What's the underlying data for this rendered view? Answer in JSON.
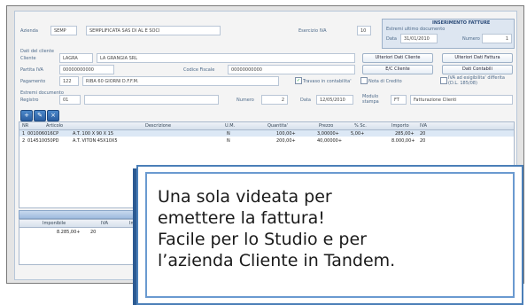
{
  "header": {
    "azienda_label": "Azienda",
    "azienda_code": "SEMP",
    "azienda_name": "SEMPLIFICATA SAS DI AL E SOCI",
    "esercizio_label": "Esercizio IVA",
    "esercizio_value": "10"
  },
  "doc_panel": {
    "title": "INSERIMENTO FATTURE",
    "last_doc_label": "Estremi ultimo documento",
    "data_label": "Data",
    "data_value": "31/01/2010",
    "numero_label": "Numero",
    "numero_value": "1"
  },
  "cliente": {
    "section_label": "Dati del cliente",
    "cliente_label": "Cliente",
    "cliente_code": "LAGRA",
    "cliente_name": "LA GRANGIA SRL",
    "piva_label": "Partita IVA",
    "piva_value": "00000000000",
    "cf_label": "Codice Fiscale",
    "cf_value": "00000000000",
    "pagamento_label": "Pagamento",
    "pagamento_code": "122",
    "pagamento_desc": "RIBA 60 GIORNI D.F.F.M.",
    "trasmesso_label": "Travaso in contabilita'",
    "nota_credito_label": "Nota di Credito",
    "iva_esigibilita_label": "IVA ad esigibilita' differita (D.L. 185/08)"
  },
  "buttons": {
    "ulteriori_cliente": "Ulteriori Dati Cliente",
    "ulteriori_fattura": "Ulteriori Dati Fattura",
    "ec_cliente": "E/C Cliente",
    "dati_contabili": "Dati Contabili"
  },
  "documento": {
    "section_label": "Estremi documento",
    "registro_label": "Registro",
    "registro_value": "01",
    "numero_label": "Numero",
    "numero_value": "2",
    "data_label": "Data",
    "data_value": "12/05/2010",
    "modulo_label": "Modulo stampa",
    "modulo_code": "FT",
    "modulo_desc": "Fatturazione Clienti"
  },
  "grid": {
    "columns": [
      "NR",
      "Articolo",
      "Descrizione",
      "U.M.",
      "Quantita'",
      "Prezzo",
      "% Sc.",
      "Importo",
      "IVA"
    ],
    "rows": [
      {
        "nr": "1",
        "articolo": "001006016CP",
        "descrizione": "A.T. 100 X 90 X 15",
        "um": "N",
        "quantita": "100,00+",
        "prezzo": "3,00000+",
        "sconto": "5,00+",
        "importo": "285,00+",
        "iva": "20"
      },
      {
        "nr": "2",
        "articolo": "014510050PD",
        "descrizione": "A.T. VITON 45X10X5",
        "um": "N",
        "quantita": "200,00+",
        "prezzo": "40,00000+",
        "sconto": "",
        "importo": "8.000,00+",
        "iva": "20"
      }
    ]
  },
  "totals": {
    "imponibile_label": "Imponibile",
    "iva_label": "IVA",
    "imposta_label": "Im",
    "imponibile_value": "8.285,00+",
    "iva_value": "20"
  },
  "callout": {
    "line1": "Una sola videata per",
    "line2": "emettere la fattura!",
    "line3": "Facile per lo Studio e per",
    "line4": "l’azienda Cliente in Tandem."
  }
}
